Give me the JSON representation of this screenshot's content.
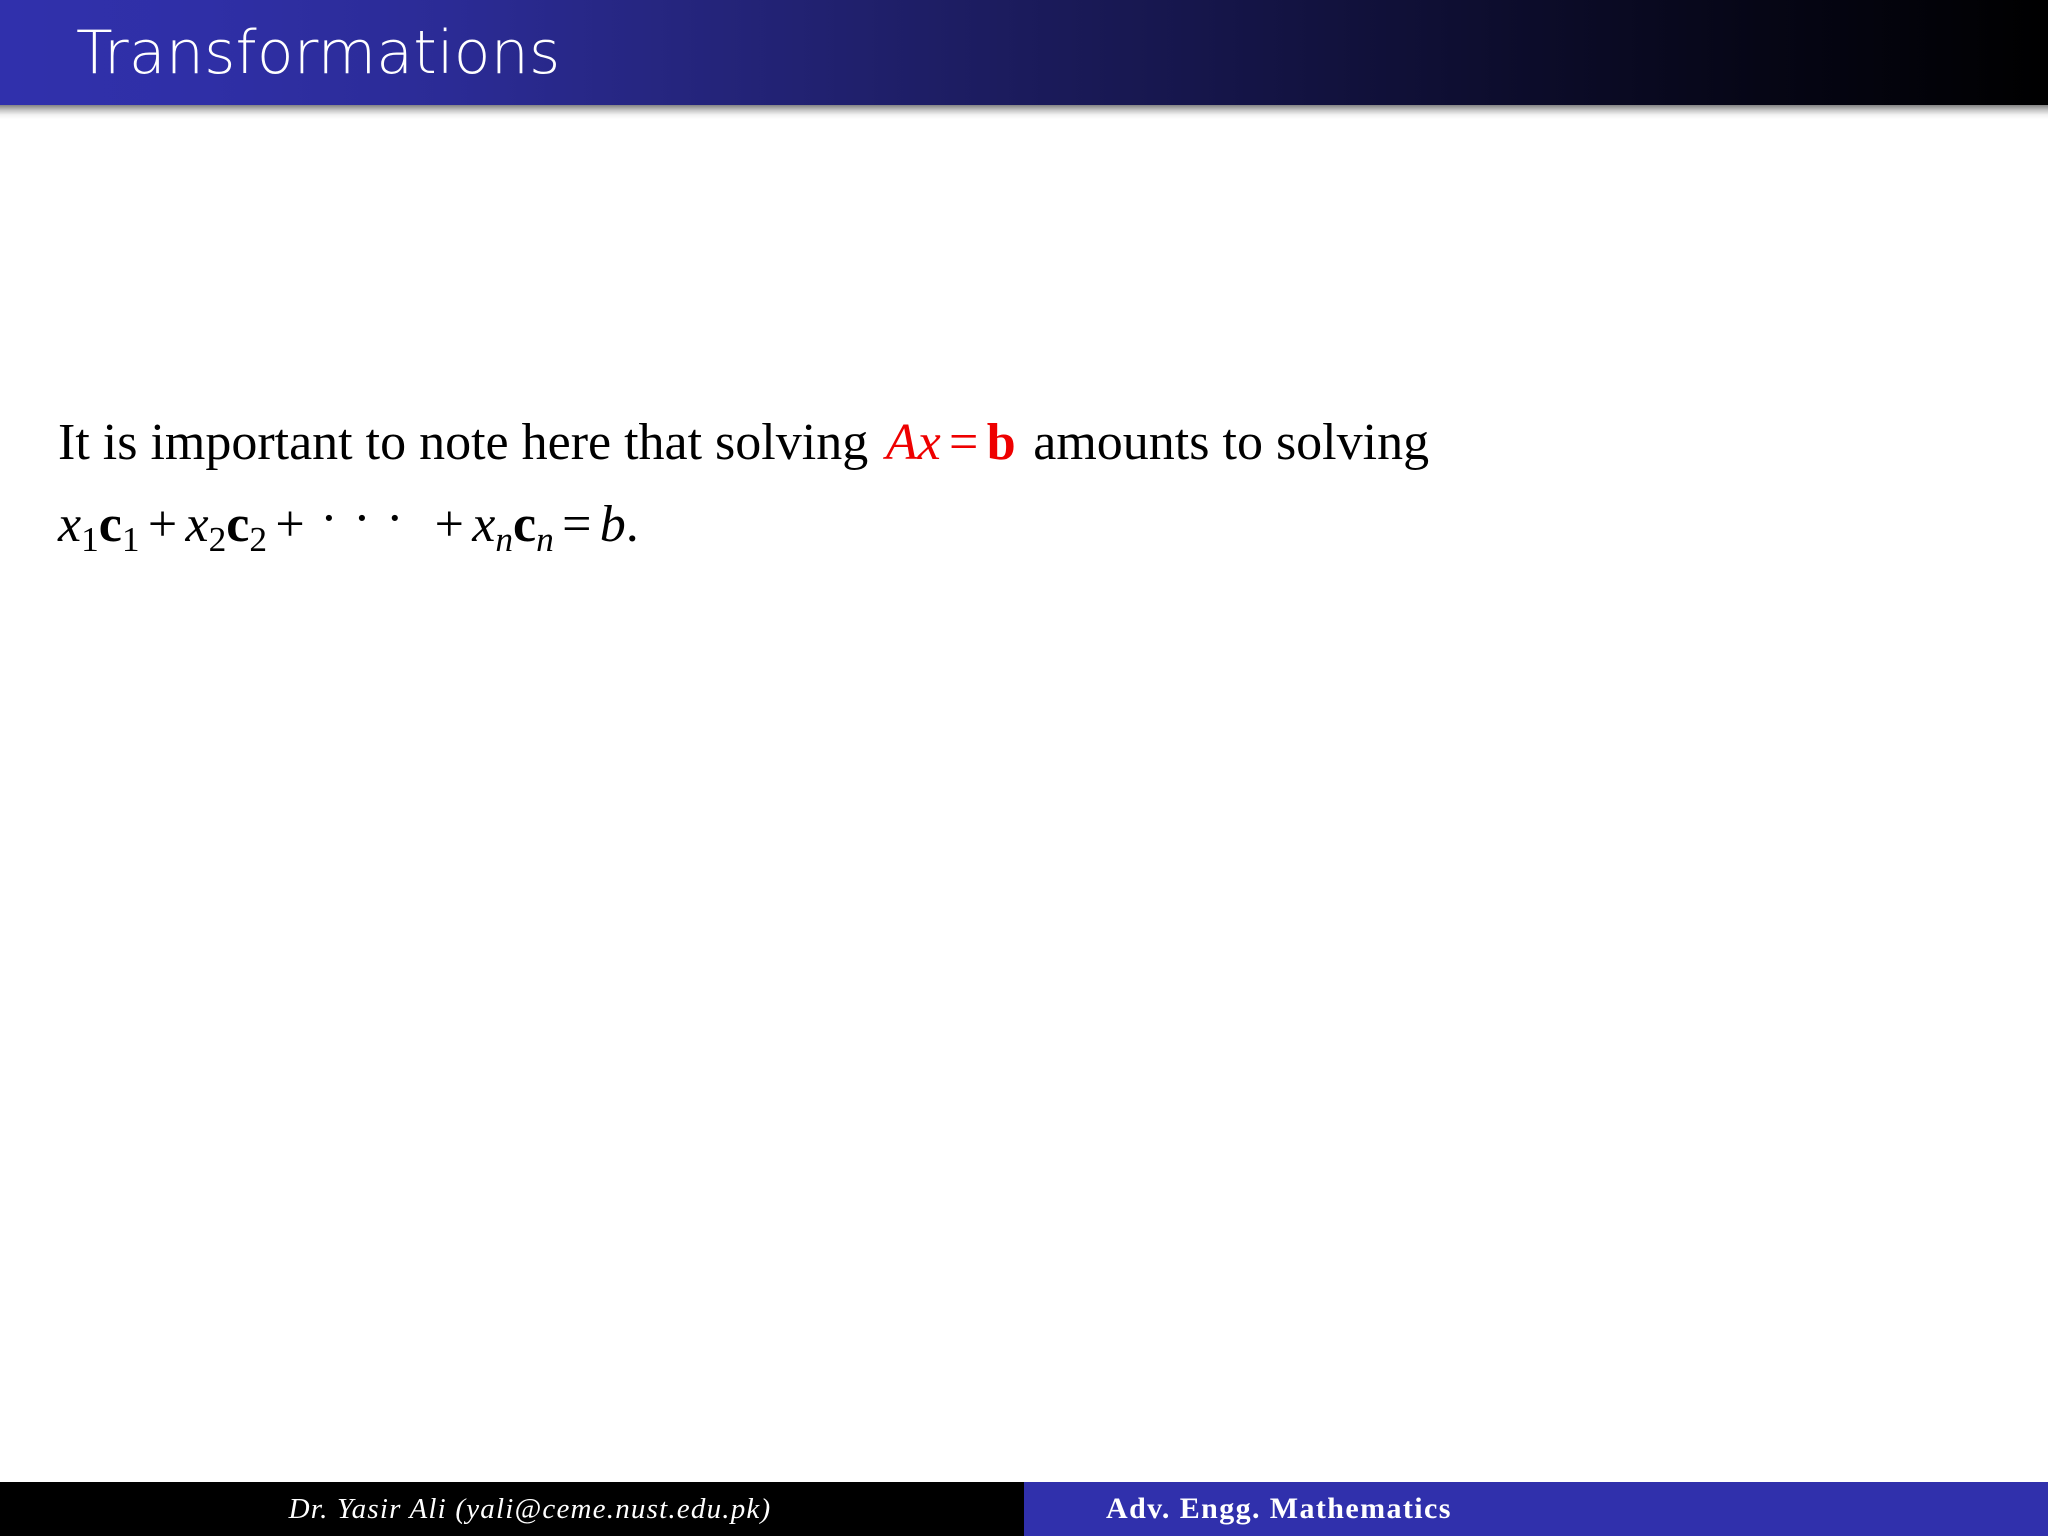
{
  "slide": {
    "title": "Transformations",
    "title_bar": {
      "gradient_from": "#3030ac",
      "gradient_to": "#000000",
      "text_color": "#ffffff"
    },
    "accent_red": "#ee0000",
    "background": "#ffffff"
  },
  "body": {
    "paragraph": {
      "lead_text": "It is important to note here that solving",
      "inline_equation": {
        "plain": "Ax = b",
        "matrix_symbol": "A",
        "vector_unknown": "x",
        "relation": "=",
        "rhs_vector": "b",
        "color": "#ee0000"
      },
      "trail_text": "amounts to solving"
    },
    "display_equation": {
      "plain": "x1c1 + x2c2 + ··· + xncn = b.",
      "terms": [
        {
          "coefficient": "x",
          "coefficient_index": "1",
          "vector": "c",
          "vector_index": "1"
        },
        {
          "coefficient": "x",
          "coefficient_index": "2",
          "vector": "c",
          "vector_index": "2"
        },
        {
          "coefficient": "x",
          "coefficient_index": "n",
          "vector": "c",
          "vector_index": "n"
        }
      ],
      "plus": "+",
      "ellipsis": "···",
      "equals": "=",
      "rhs": "b",
      "period": "."
    }
  },
  "footer": {
    "author": "Dr.  Yasir Ali (yali@ceme.nust.edu.pk)",
    "course": "Adv. Engg. Mathematics",
    "left_bg": "#000000",
    "right_bg": "#3030ac"
  }
}
